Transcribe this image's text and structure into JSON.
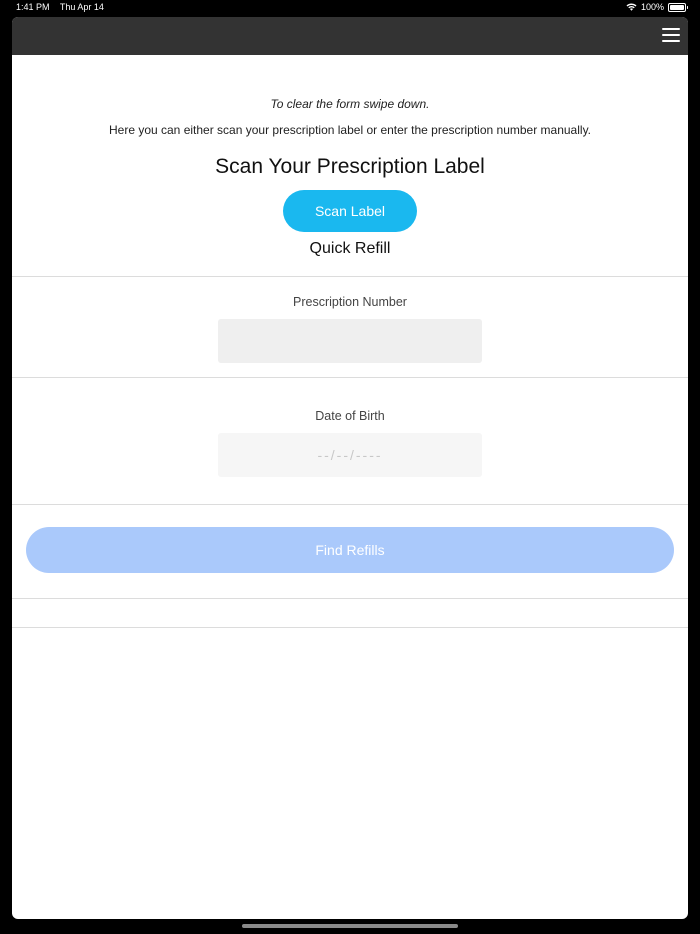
{
  "status_bar": {
    "time": "1:41 PM",
    "date": "Thu Apr 14",
    "battery": "100%",
    "icons": [
      "wifi-icon",
      "battery-icon"
    ]
  },
  "navbar": {
    "menu_icon": "hamburger-menu-icon"
  },
  "form": {
    "hint": "To clear the form swipe down.",
    "intro": "Here you can either scan your prescription label or enter the prescription number manually.",
    "scan_title": "Scan Your Prescription Label",
    "scan_button": "Scan Label",
    "quick_refill": "Quick Refill",
    "prescription_label": "Prescription Number",
    "prescription_value": "",
    "dob_label": "Date of Birth",
    "dob_placeholder": "--/--/----",
    "find_button": "Find Refills"
  },
  "colors": {
    "navbar": "#333333",
    "scan_button": "#1ab8ef",
    "find_button_disabled": "#aac9fb"
  }
}
